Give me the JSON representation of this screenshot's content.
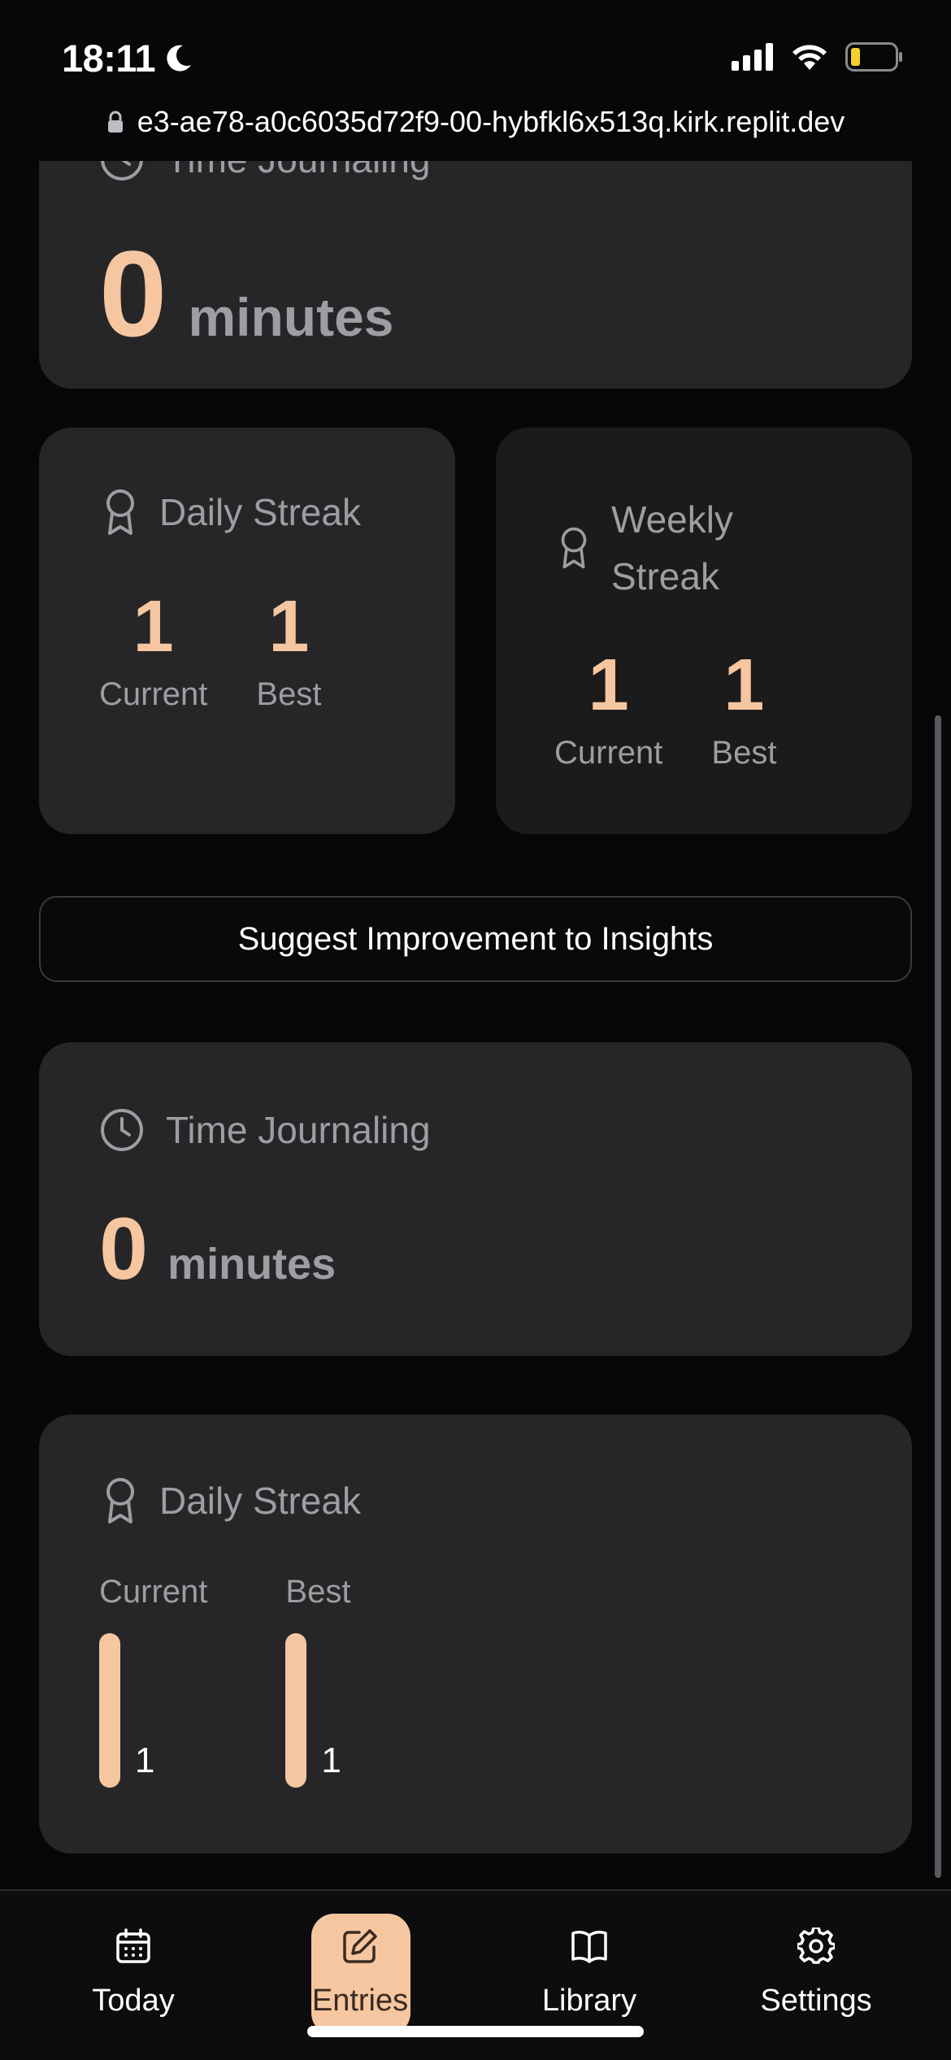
{
  "status_bar": {
    "time": "18:11",
    "url": "e3-ae78-a0c6035d72f9-00-hybfkl6x513q.kirk.replit.dev"
  },
  "top_card": {
    "title_partial": "Time Journaling",
    "value": "0",
    "unit": "minutes"
  },
  "daily_streak": {
    "title": "Daily Streak",
    "current_value": "1",
    "current_label": "Current",
    "best_value": "1",
    "best_label": "Best"
  },
  "weekly_streak": {
    "title_line1": "Weekly",
    "title_line2": "Streak",
    "current_value": "1",
    "current_label": "Current",
    "best_value": "1",
    "best_label": "Best"
  },
  "suggest_button": {
    "label": "Suggest Improvement to Insights"
  },
  "time_journaling": {
    "title": "Time Journaling",
    "value": "0",
    "unit": "minutes"
  },
  "daily_streak_chart": {
    "title": "Daily Streak",
    "current_label": "Current",
    "current_value": "1",
    "best_label": "Best",
    "best_value": "1"
  },
  "tabs": [
    {
      "label": "Today",
      "icon": "calendar-icon",
      "active": false
    },
    {
      "label": "Entries",
      "icon": "edit-icon",
      "active": true
    },
    {
      "label": "Library",
      "icon": "book-icon",
      "active": false
    },
    {
      "label": "Settings",
      "icon": "gear-icon",
      "active": false
    }
  ],
  "colors": {
    "accent": "#f6c6a0",
    "card": "#262628",
    "background": "#070709",
    "muted_text": "#9d9da2"
  }
}
